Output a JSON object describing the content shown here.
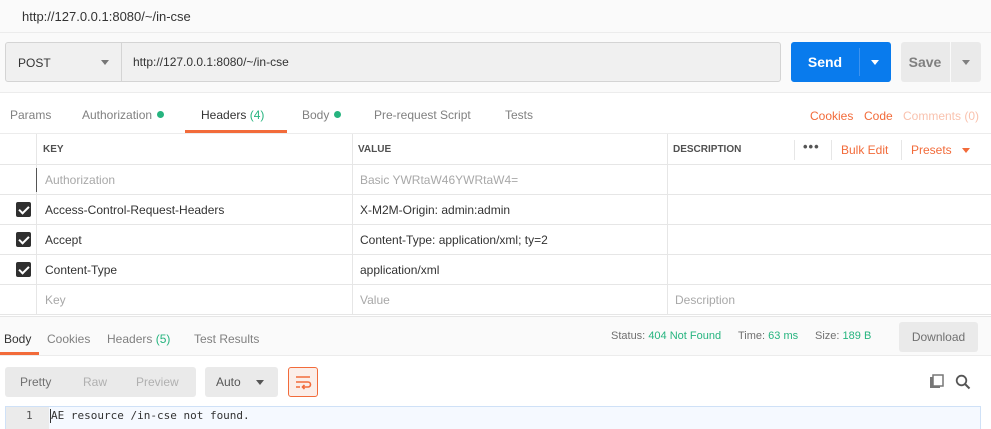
{
  "window": {
    "title": "http://127.0.0.1:8080/~/in-cse"
  },
  "request": {
    "method": "POST",
    "url": "http://127.0.0.1:8080/~/in-cse",
    "send_label": "Send",
    "save_label": "Save"
  },
  "request_tabs": {
    "params": "Params",
    "authorization": "Authorization",
    "headers": "Headers",
    "headers_count": "(4)",
    "body": "Body",
    "prerequest": "Pre-request Script",
    "tests": "Tests",
    "cookies": "Cookies",
    "code": "Code",
    "comments": "Comments (0)"
  },
  "headers_table": {
    "col_key": "KEY",
    "col_value": "VALUE",
    "col_description": "DESCRIPTION",
    "more": "•••",
    "bulk_edit": "Bulk Edit",
    "presets": "Presets",
    "rows": [
      {
        "key": "Authorization",
        "value": "Basic YWRtaW46YWRtaW4=",
        "checked": false,
        "dim": true
      },
      {
        "key": "Access-Control-Request-Headers",
        "value": "X-M2M-Origin: admin:admin",
        "checked": true
      },
      {
        "key": "Accept",
        "value": "Content-Type: application/xml; ty=2",
        "checked": true
      },
      {
        "key": "Content-Type",
        "value": "application/xml",
        "checked": true
      }
    ],
    "placeholder_key": "Key",
    "placeholder_value": "Value",
    "placeholder_description": "Description"
  },
  "response": {
    "tabs": {
      "body": "Body",
      "cookies": "Cookies",
      "headers": "Headers",
      "headers_count": "(5)",
      "test_results": "Test Results"
    },
    "status_label": "Status:",
    "status_value": "404 Not Found",
    "time_label": "Time:",
    "time_value": "63 ms",
    "size_label": "Size:",
    "size_value": "189 B",
    "download_label": "Download",
    "view_modes": [
      "Pretty",
      "Raw",
      "Preview"
    ],
    "format": "Auto",
    "line_number": "1",
    "body_text": "AE resource /in-cse not found."
  },
  "colors": {
    "accent": "#f26b3a",
    "send": "#097bed",
    "success": "#26b47f"
  }
}
